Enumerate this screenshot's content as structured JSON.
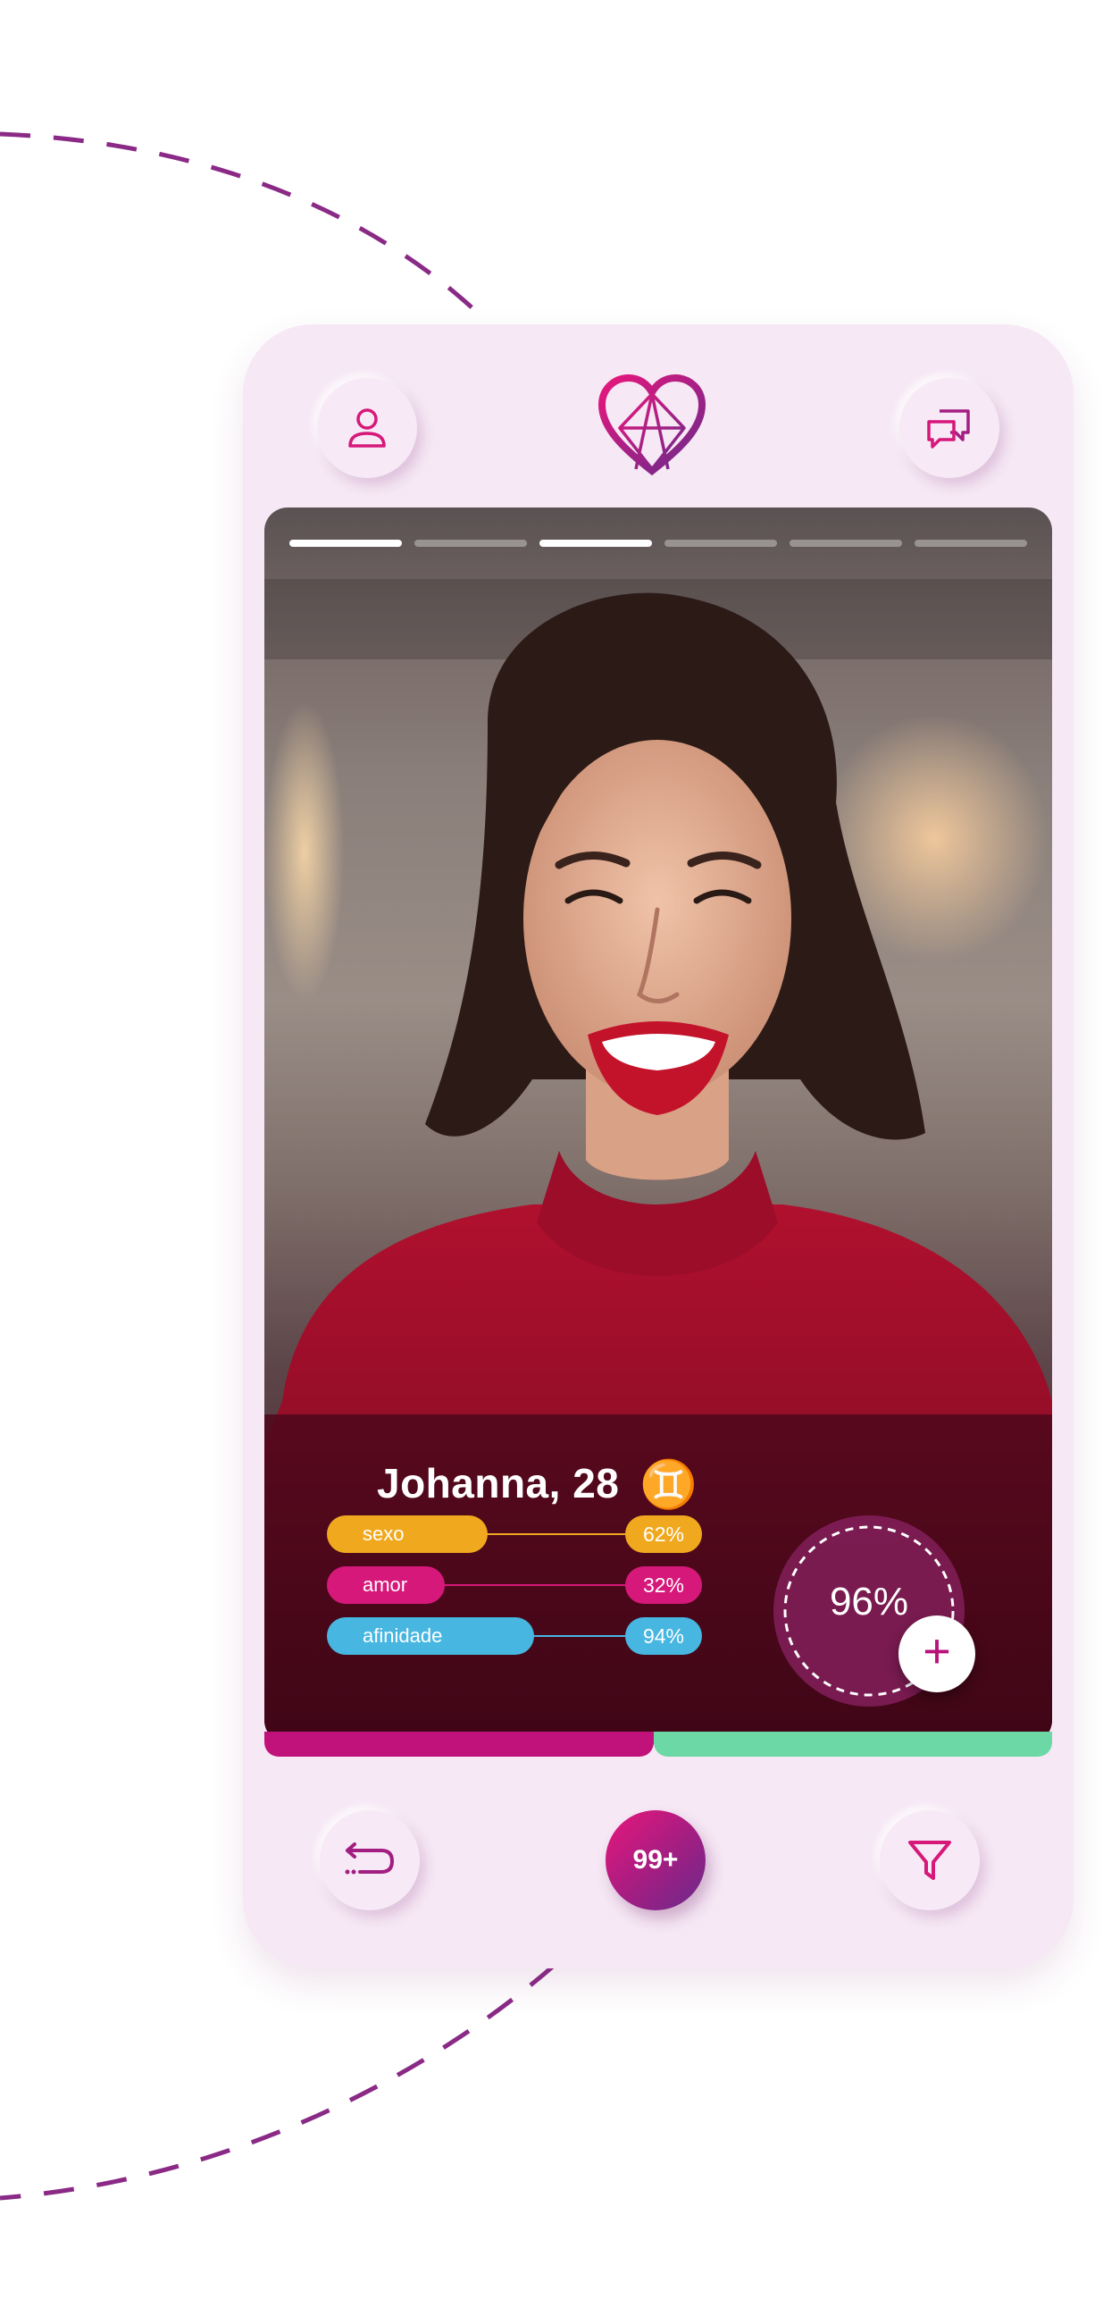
{
  "header": {
    "profile_icon": "user-icon",
    "logo_icon": "heart-logo-icon",
    "chat_icon": "chat-bubbles-icon"
  },
  "profile": {
    "name_age": "Johanna, 28",
    "zodiac_symbol": "♊",
    "photo_index": 3,
    "photo_total": 6
  },
  "stats": [
    {
      "label": "sexo",
      "percent": "62%",
      "value": 0.62,
      "color": "#f0a91f"
    },
    {
      "label": "amor",
      "percent": "32%",
      "value": 0.32,
      "color": "#d6187a"
    },
    {
      "label": "afinidade",
      "percent": "94%",
      "value": 0.94,
      "color": "#47b6e0"
    }
  ],
  "match": {
    "percent": "96%",
    "plus": "+"
  },
  "footer": {
    "back_icon": "undo-return-icon",
    "badge_count": "99+",
    "filter_icon": "filter-funnel-icon"
  },
  "colors": {
    "accent": "#d6187a",
    "purple": "#7b2a86",
    "background": "#f6e8f5",
    "green": "#6bd8a6"
  }
}
